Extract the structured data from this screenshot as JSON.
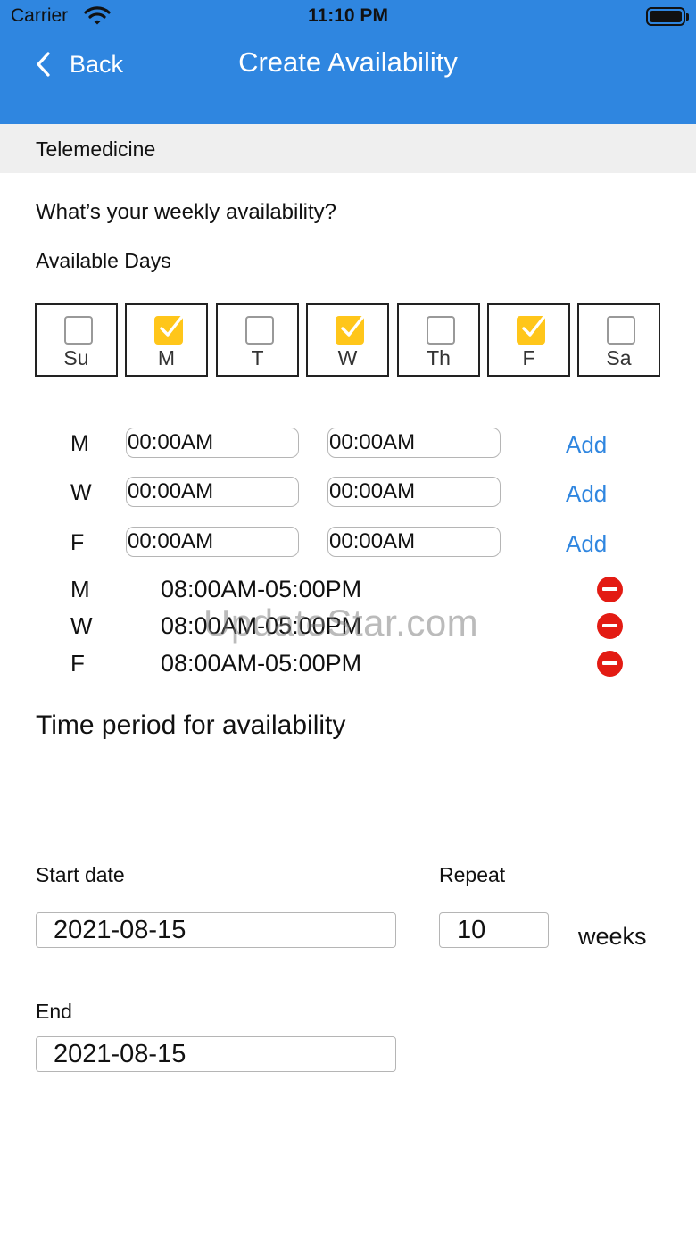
{
  "status": {
    "carrier": "Carrier",
    "time": "11:10 PM"
  },
  "nav": {
    "back_label": "Back",
    "title": "Create Availability"
  },
  "section": {
    "title": "Telemedicine"
  },
  "question": "What’s your weekly availability?",
  "available_days_label": "Available Days",
  "days": [
    {
      "label": "Su",
      "checked": false
    },
    {
      "label": "M",
      "checked": true
    },
    {
      "label": "T",
      "checked": false
    },
    {
      "label": "W",
      "checked": true
    },
    {
      "label": "Th",
      "checked": false
    },
    {
      "label": "F",
      "checked": true
    },
    {
      "label": "Sa",
      "checked": false
    }
  ],
  "slots": [
    {
      "day": "M",
      "start": "00:00AM",
      "end": "00:00AM",
      "add_label": "Add"
    },
    {
      "day": "W",
      "start": "00:00AM",
      "end": "00:00AM",
      "add_label": "Add"
    },
    {
      "day": "F",
      "start": "00:00AM",
      "end": "00:00AM",
      "add_label": "Add"
    }
  ],
  "schedule": [
    {
      "day": "M",
      "range": "08:00AM-05:00PM"
    },
    {
      "day": "W",
      "range": "08:00AM-05:00PM"
    },
    {
      "day": "F",
      "range": "08:00AM-05:00PM"
    }
  ],
  "watermark": "UpdateStar.com",
  "period_title": "Time period for availability",
  "start": {
    "label": "Start date",
    "value": "2021-08-15"
  },
  "repeat": {
    "label": "Repeat",
    "value": "10",
    "unit": "weeks"
  },
  "end": {
    "label": "End",
    "value": "2021-08-15"
  },
  "colors": {
    "nav": "#2f86e0",
    "checkbox": "#ffc61a",
    "remove": "#e31b13",
    "link": "#2f86e0"
  }
}
